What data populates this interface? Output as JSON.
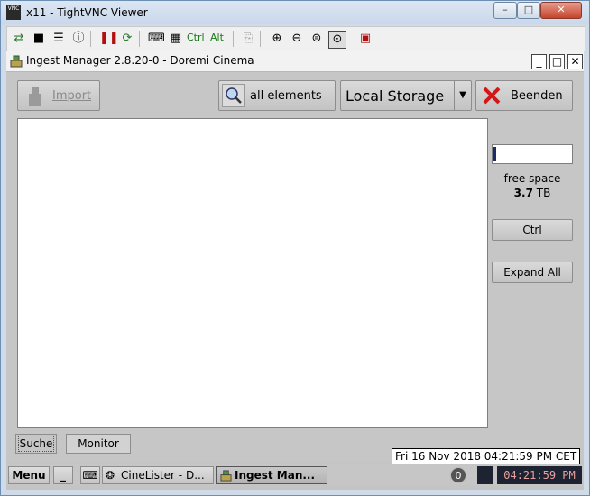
{
  "vnc_window": {
    "title": "x11 - TightVNC Viewer",
    "app_icon_text": "VNC",
    "toolbar": {
      "ctrl_label": "Ctrl",
      "alt_label": "Alt"
    }
  },
  "app": {
    "title": "Ingest Manager 2.8.20-0 - Doremi Cinema",
    "import_label": "Import",
    "search_label": "all elements",
    "storage_selected": "Local Storage",
    "quit_label": "Beenden",
    "free_space_label": "free space",
    "free_space_value": "3.7",
    "free_space_unit": "TB",
    "free_space_used_fraction": 0.03,
    "ctrl_button": "Ctrl",
    "expand_all_button": "Expand All",
    "tabs": [
      {
        "label": "Suche"
      },
      {
        "label": "Monitor"
      }
    ]
  },
  "taskbar": {
    "menu_label": "Menu",
    "min_label": "_",
    "task1_label": "CineLister - D...",
    "task2_label": "Ingest Man...",
    "badge_count": "0",
    "clock_time": "04:21:59 PM",
    "clock_tooltip": "Fri 16 Nov 2018 04:21:59 PM CET"
  }
}
